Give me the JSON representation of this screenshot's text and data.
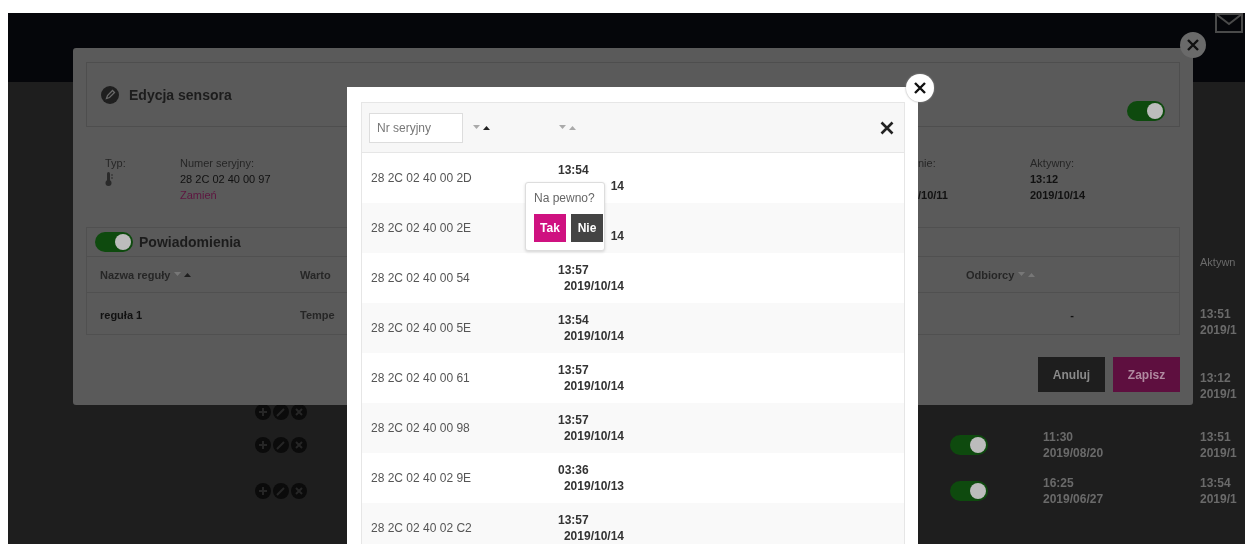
{
  "background_table": {
    "column_header": "Aktywn",
    "rows": [
      {
        "kind": "partial",
        "right_time": "13:51",
        "right_date": "2019/1"
      },
      {
        "kind": "actions",
        "right_time": "13:12",
        "right_date": "2019/1"
      },
      {
        "kind": "full",
        "toggle_on": true,
        "time": "11:30",
        "date": "2019/08/20",
        "right_time": "13:51",
        "right_date": "2019/1"
      },
      {
        "kind": "full",
        "toggle_on": true,
        "time": "16:25",
        "date": "2019/06/27",
        "right_time": "13:54",
        "right_date": "2019/1"
      }
    ]
  },
  "sensor_modal": {
    "title": "Edycja sensora",
    "enabled": true,
    "fields": [
      {
        "kind": "type",
        "label": "Typ:"
      },
      {
        "kind": "serial",
        "label": "Numer seryjny:",
        "value": "28 2C 02 40 00 97",
        "link": "Zamień"
      },
      {
        "kind": "datetime",
        "label": "nie:",
        "lines": [
          "/10/11"
        ]
      },
      {
        "kind": "datetime",
        "label": "Aktywny:",
        "lines": [
          "13:12",
          "2019/10/14"
        ]
      }
    ],
    "notifications": {
      "title": "Powiadomienia",
      "on": true,
      "columns": [
        {
          "label": "Nazwa reguły",
          "sort_active": true
        },
        {
          "label": "Warto"
        },
        {
          "label": "Odbiorcy",
          "sort_active": false
        }
      ],
      "rows": [
        [
          "reguła 1",
          "Tempe",
          "-"
        ]
      ]
    },
    "buttons": [
      {
        "label": "Anuluj",
        "kind": "secondary"
      },
      {
        "label": "Zapisz",
        "kind": "primary"
      }
    ]
  },
  "serial_modal": {
    "filter_placeholder": "Nr seryjny",
    "sort": [
      {
        "active": true
      },
      {
        "active": false
      }
    ],
    "rows": [
      {
        "serial": "28 2C 02 40 00 2D",
        "time": "13:54",
        "date": "14"
      },
      {
        "serial": "28 2C 02 40 00 2E",
        "date": "14"
      },
      {
        "serial": "28 2C 02 40 00 54",
        "time": "13:57",
        "date": "2019/10/14"
      },
      {
        "serial": "28 2C 02 40 00 5E",
        "time": "13:54",
        "date": "2019/10/14"
      },
      {
        "serial": "28 2C 02 40 00 61",
        "time": "13:57",
        "date": "2019/10/14"
      },
      {
        "serial": "28 2C 02 40 00 98",
        "time": "13:57",
        "date": "2019/10/14"
      },
      {
        "serial": "28 2C 02 40 02 9E",
        "time": "03:36",
        "date": "2019/10/13"
      },
      {
        "serial": "28 2C 02 40 02 C2",
        "time": "13:57",
        "date": "2019/10/14"
      }
    ],
    "confirm": {
      "question": "Na pewno?",
      "buttons": [
        {
          "label": "Tak",
          "kind": "confirm"
        },
        {
          "label": "Nie",
          "kind": "cancel"
        }
      ]
    }
  }
}
